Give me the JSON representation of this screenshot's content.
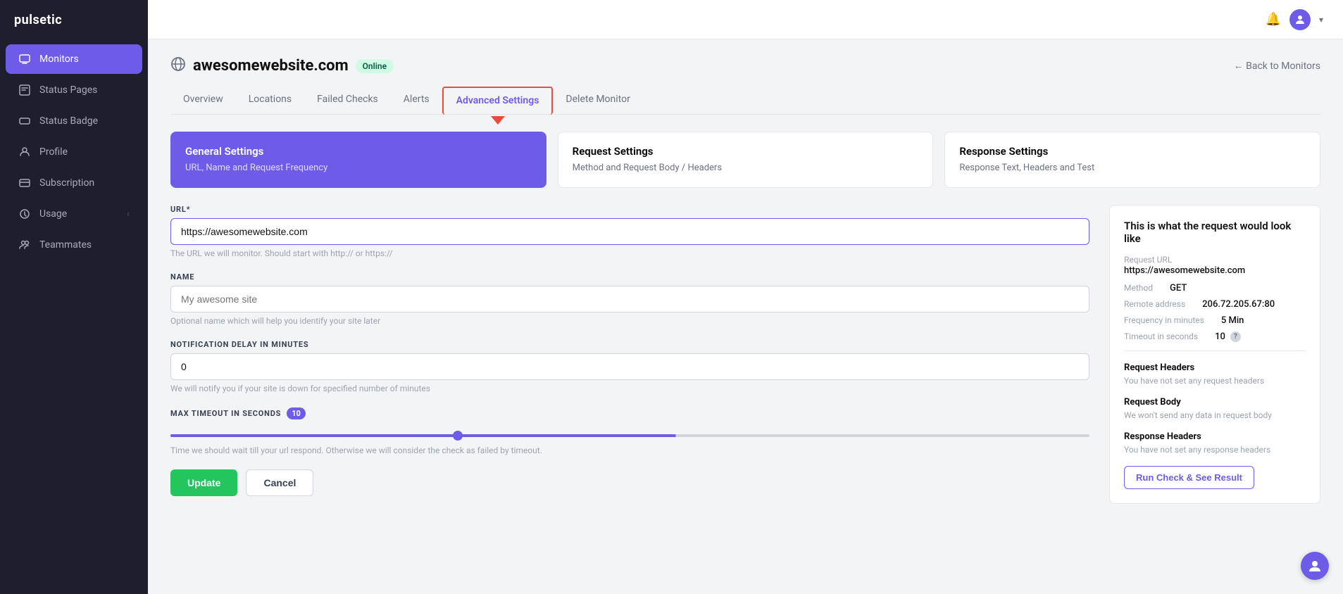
{
  "app": {
    "logo": "pulsetic"
  },
  "sidebar": {
    "items": [
      {
        "id": "monitors",
        "label": "Monitors",
        "icon": "⬡",
        "active": true
      },
      {
        "id": "status-pages",
        "label": "Status Pages",
        "icon": "☰",
        "active": false
      },
      {
        "id": "status-badge",
        "label": "Status Badge",
        "icon": "◻",
        "active": false
      },
      {
        "id": "profile",
        "label": "Profile",
        "icon": "○",
        "active": false
      },
      {
        "id": "subscription",
        "label": "Subscription",
        "icon": "◻",
        "active": false
      },
      {
        "id": "usage",
        "label": "Usage",
        "icon": "○",
        "active": false
      },
      {
        "id": "teammates",
        "label": "Teammates",
        "icon": "○",
        "active": false
      }
    ]
  },
  "topbar": {
    "bell_icon": "🔔",
    "avatar_initials": "U"
  },
  "monitor": {
    "icon": "⊙",
    "title": "awesomewebsite.com",
    "status": "Online",
    "back_label": "← Back to Monitors"
  },
  "tabs": [
    {
      "id": "overview",
      "label": "Overview",
      "active": false
    },
    {
      "id": "locations",
      "label": "Locations",
      "active": false
    },
    {
      "id": "failed-checks",
      "label": "Failed Checks",
      "active": false
    },
    {
      "id": "alerts",
      "label": "Alerts",
      "active": false
    },
    {
      "id": "advanced-settings",
      "label": "Advanced Settings",
      "active": true
    },
    {
      "id": "delete-monitor",
      "label": "Delete Monitor",
      "active": false
    }
  ],
  "settings_cards": [
    {
      "id": "general",
      "title": "General Settings",
      "desc": "URL, Name and Request Frequency",
      "active": true
    },
    {
      "id": "request",
      "title": "Request Settings",
      "desc": "Method and Request Body / Headers",
      "active": false
    },
    {
      "id": "response",
      "title": "Response Settings",
      "desc": "Response Text, Headers and Test",
      "active": false
    }
  ],
  "form": {
    "url_label": "URL*",
    "url_value": "https://awesomewebsite.com",
    "url_hint": "The URL we will monitor. Should start with http:// or https://",
    "name_label": "NAME",
    "name_placeholder": "My awesome site",
    "name_hint": "Optional name which will help you identify your site later",
    "notification_label": "NOTIFICATION DELAY IN MINUTES",
    "notification_value": "0",
    "notification_hint": "We will notify you if your site is down for specified number of minutes",
    "timeout_label": "MAX TIMEOUT IN SECONDS",
    "timeout_value": "10",
    "timeout_hint": "Time we should wait till your url respond. Otherwise we will consider the check as failed by timeout.",
    "update_btn": "Update",
    "cancel_btn": "Cancel"
  },
  "info_panel": {
    "title": "This is what the request would look like",
    "request_url_label": "Request URL",
    "request_url_value": "https://awesomewebsite.com",
    "method_label": "Method",
    "method_value": "GET",
    "remote_address_label": "Remote address",
    "remote_address_value": "206.72.205.67:80",
    "frequency_label": "Frequency in minutes",
    "frequency_value": "5 Min",
    "timeout_label": "Timeout in seconds",
    "timeout_value": "10",
    "request_headers_title": "Request Headers",
    "request_headers_text": "You have not set any request headers",
    "request_body_title": "Request Body",
    "request_body_text": "We won't send any data in request body",
    "response_headers_title": "Response Headers",
    "response_headers_text": "You have not set any response headers",
    "run_check_btn": "Run Check & See Result"
  }
}
